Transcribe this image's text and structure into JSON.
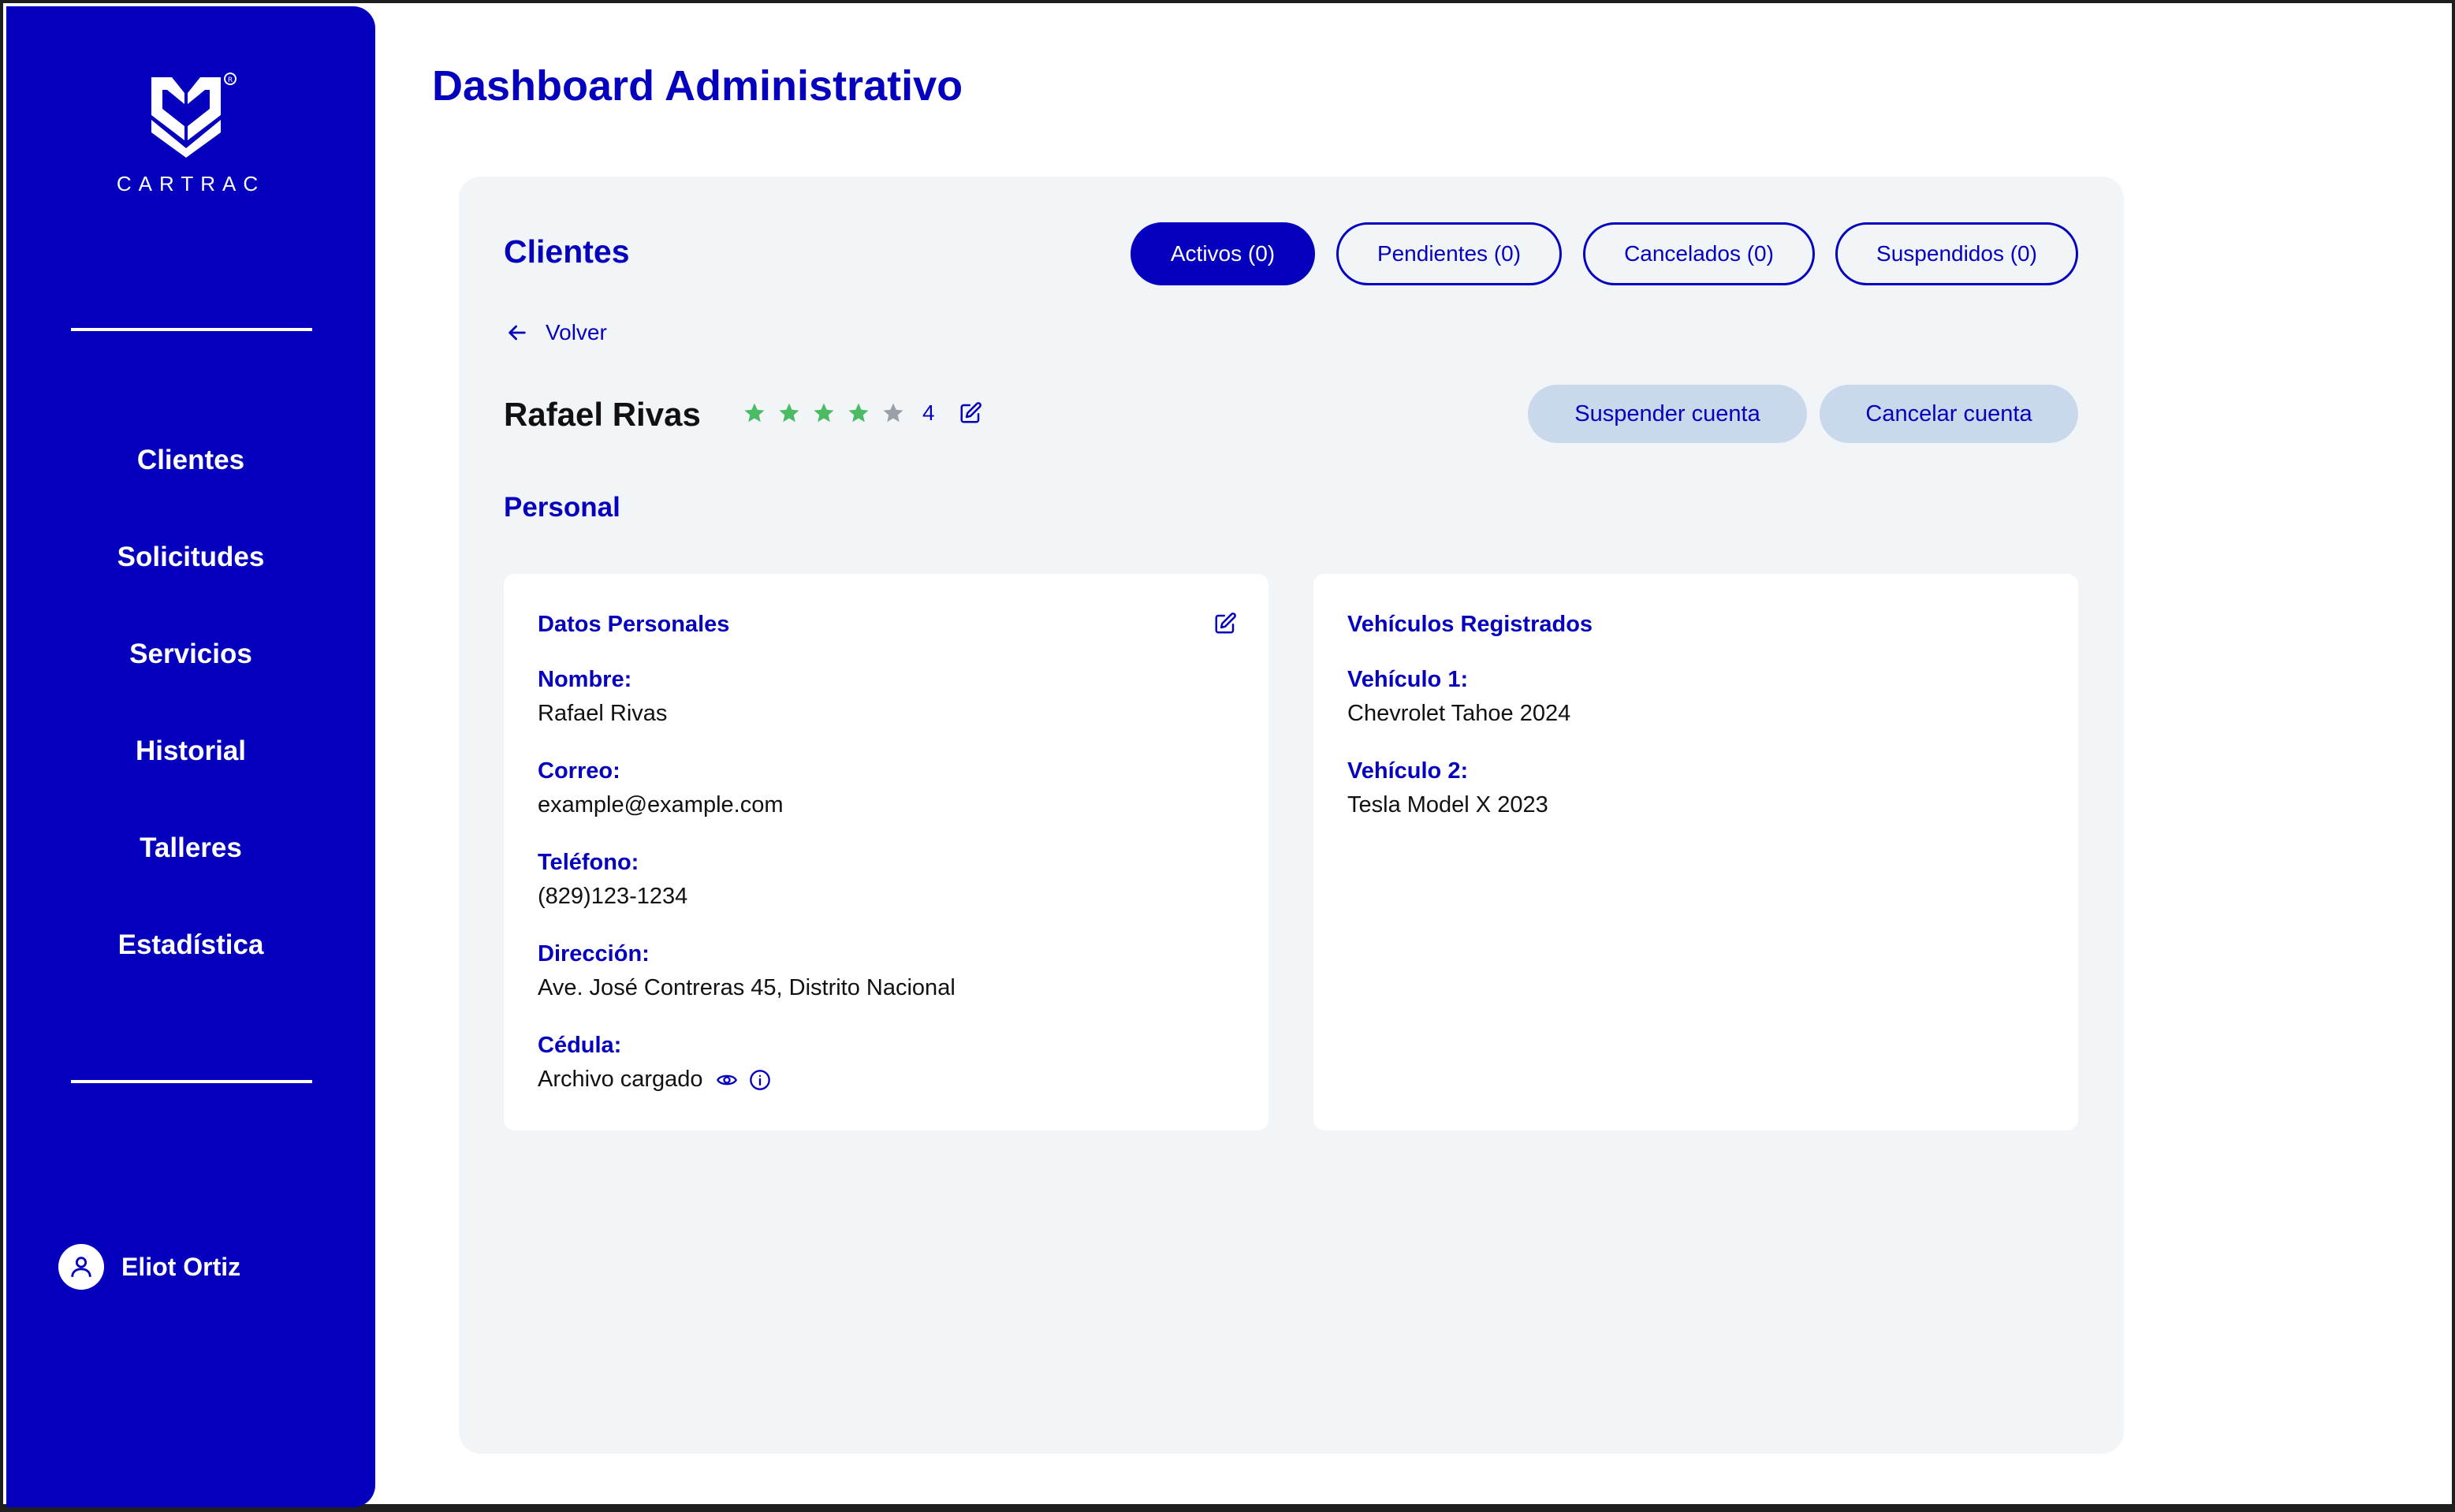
{
  "sidebar": {
    "logo_text": "CARTRAC",
    "nav": [
      "Clientes",
      "Solicitudes",
      "Servicios",
      "Historial",
      "Talleres",
      "Estadística"
    ],
    "user": "Eliot Ortiz"
  },
  "header": {
    "title": "Dashboard Administrativo"
  },
  "panel": {
    "title": "Clientes",
    "filters": [
      {
        "label": "Activos (0)",
        "active": true
      },
      {
        "label": "Pendientes (0)",
        "active": false
      },
      {
        "label": "Cancelados (0)",
        "active": false
      },
      {
        "label": "Suspendidos (0)",
        "active": false
      }
    ],
    "back_label": "Volver",
    "client": {
      "name": "Rafael Rivas",
      "rating": 4,
      "rating_max": 5,
      "rating_label": "4"
    },
    "actions": {
      "suspend": "Suspender cuenta",
      "cancel": "Cancelar cuenta"
    },
    "section_label": "Personal",
    "personal_card": {
      "title": "Datos Personales",
      "fields": [
        {
          "label": "Nombre:",
          "value": "Rafael Rivas"
        },
        {
          "label": "Correo:",
          "value": "example@example.com"
        },
        {
          "label": "Teléfono:",
          "value": "(829)123-1234"
        },
        {
          "label": "Dirección:",
          "value": "Ave. José Contreras 45, Distrito Nacional"
        },
        {
          "label": "Cédula:",
          "value": "Archivo cargado"
        }
      ]
    },
    "vehicles_card": {
      "title": "Vehículos Registrados",
      "fields": [
        {
          "label": "Vehículo 1:",
          "value": "Chevrolet Tahoe 2024"
        },
        {
          "label": "Vehículo 2:",
          "value": "Tesla Model X 2023"
        }
      ]
    }
  },
  "colors": {
    "primary": "#0500be",
    "panel_bg": "#f2f5f8",
    "soft_button": "#c9d8ea",
    "star_filled": "#4cbb63",
    "star_empty": "#9aa0a8"
  }
}
